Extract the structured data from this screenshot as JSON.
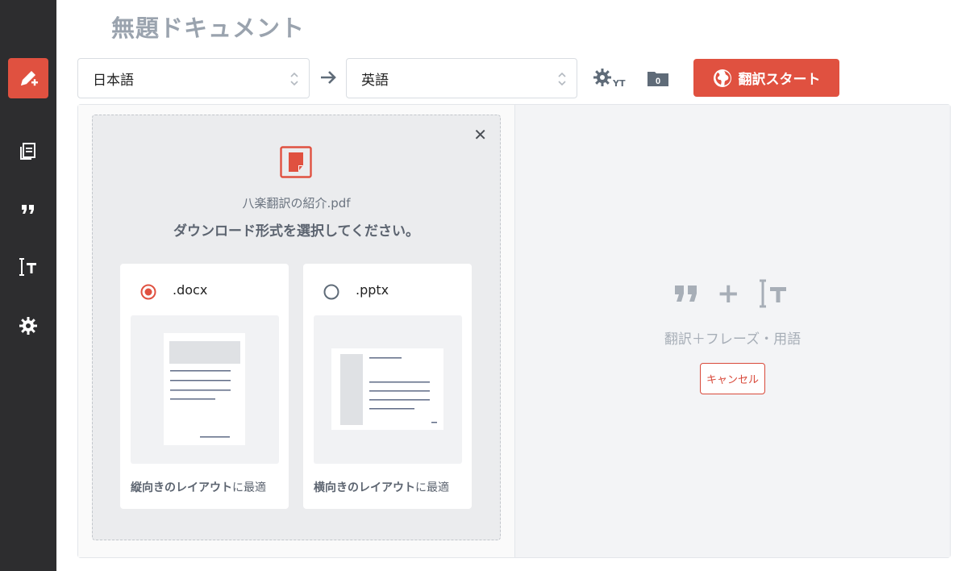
{
  "document": {
    "title": "無題ドキュメント"
  },
  "sidebar": {
    "items": [
      {
        "name": "new-translation",
        "icon": "pencil-plus-icon",
        "active": true
      },
      {
        "name": "documents",
        "icon": "documents-icon",
        "active": false
      },
      {
        "name": "phrases",
        "icon": "quote-icon",
        "active": false
      },
      {
        "name": "terms",
        "icon": "text-cursor-icon",
        "active": false
      },
      {
        "name": "settings",
        "icon": "gear-icon",
        "active": false
      }
    ]
  },
  "toolbar": {
    "source_lang": "日本語",
    "target_lang": "英語",
    "gear_suffix": "YT",
    "folder_count": "0",
    "start_label": "翻訳スタート"
  },
  "upload": {
    "file_name": "八楽翻訳の紹介.pdf",
    "prompt": "ダウンロード形式を選択してください。",
    "formats": [
      {
        "ext": ".docx",
        "selected": true,
        "caption_bold": "縦向きのレイアウト",
        "caption_rest": "に最適"
      },
      {
        "ext": ".pptx",
        "selected": false,
        "caption_bold": "横向きのレイアウト",
        "caption_rest": "に最適"
      }
    ]
  },
  "result": {
    "empty_text": "翻訳＋フレーズ・用語",
    "plus": "+",
    "cancel_label": "キャンセル"
  },
  "colors": {
    "accent": "#e05140",
    "sidebar": "#2d2d2f",
    "muted": "#a7aeb7"
  }
}
